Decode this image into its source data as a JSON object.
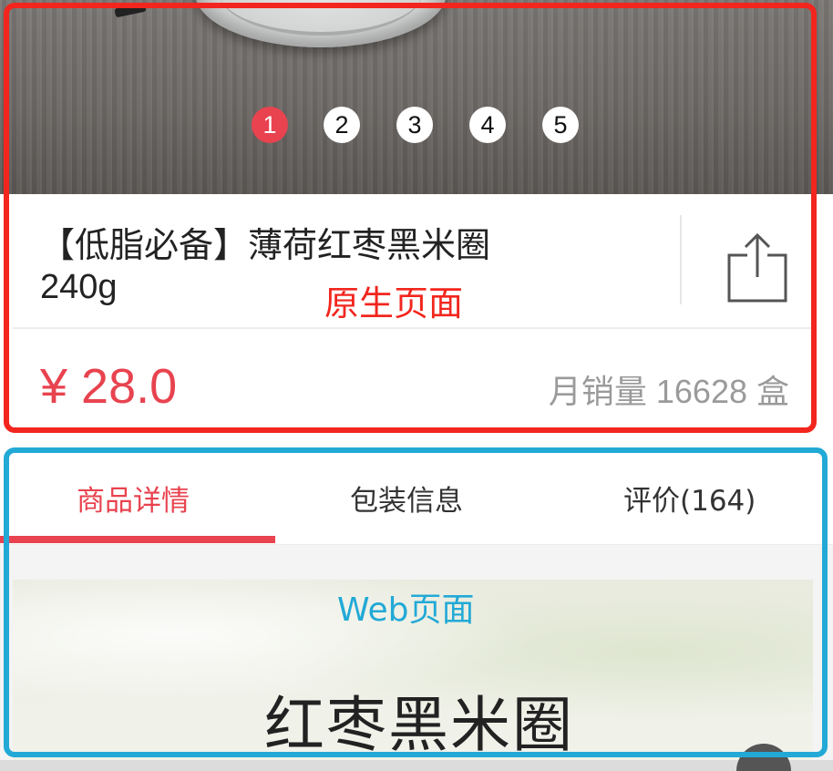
{
  "carousel": {
    "dots": [
      "1",
      "2",
      "3",
      "4",
      "5"
    ],
    "active_index": 0
  },
  "product": {
    "title_line1": "【低脂必备】薄荷红枣黑米圈",
    "title_line2": "240g",
    "price": "¥ 28.0",
    "sales": "月销量  16628 盒"
  },
  "tabs": {
    "detail": "商品详情",
    "packaging": "包装信息",
    "reviews": "评价(164)"
  },
  "web_content": {
    "title": "红枣黑米圈"
  },
  "annotations": {
    "native_label": "原生页面",
    "web_label": "Web页面"
  },
  "colors": {
    "accent_red": "#e8434f",
    "native_frame": "#f2261e",
    "web_frame": "#22a9d6"
  },
  "icons": {
    "share": "share-icon"
  }
}
